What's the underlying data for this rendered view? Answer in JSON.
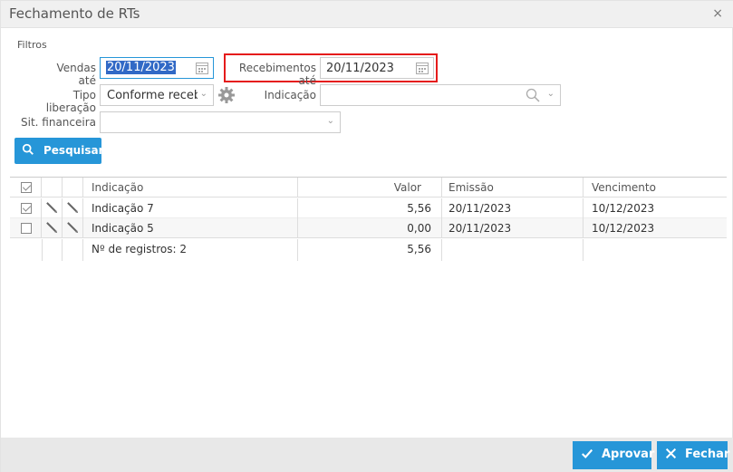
{
  "window": {
    "title": "Fechamento de RTs",
    "close_icon": "×"
  },
  "filters": {
    "section_label": "Filtros",
    "vendas_ate": {
      "label": "Vendas até",
      "value": "20/11/2023"
    },
    "recebimentos_ate": {
      "label": "Recebimentos até",
      "value": "20/11/2023"
    },
    "tipo_liberacao": {
      "label": "Tipo liberação",
      "value": "Conforme receb"
    },
    "indicacao": {
      "label": "Indicação",
      "value": ""
    },
    "sit_financeira": {
      "label": "Sit. financeira",
      "value": ""
    },
    "search_button": "Pesquisar"
  },
  "grid": {
    "columns": [
      "",
      "",
      "",
      "Indicação",
      "Valor",
      "Emissão",
      "Vencimento"
    ],
    "rows": [
      {
        "checked": true,
        "indicacao": "Indicação 7",
        "valor": "5,56",
        "emissao": "20/11/2023",
        "vencimento": "10/12/2023"
      },
      {
        "checked": false,
        "indicacao": "Indicação 5",
        "valor": "0,00",
        "emissao": "20/11/2023",
        "vencimento": "10/12/2023"
      }
    ],
    "footer": {
      "registros": "Nº de registros: 2",
      "total": "5,56"
    }
  },
  "actions": {
    "approve": "Aprovar",
    "close": "Fechar"
  },
  "colors": {
    "accent": "#2696d8",
    "highlight": "#e51b1b"
  }
}
